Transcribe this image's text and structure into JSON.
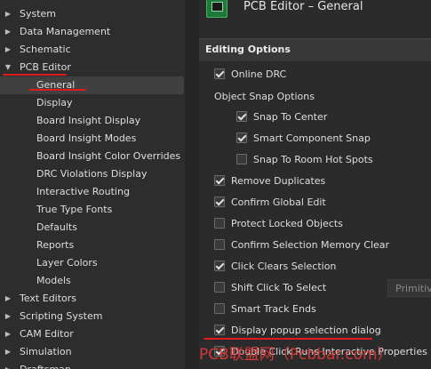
{
  "sidebar": {
    "items": [
      {
        "label": "System",
        "level": 0,
        "expanded": false
      },
      {
        "label": "Data Management",
        "level": 0,
        "expanded": false
      },
      {
        "label": "Schematic",
        "level": 0,
        "expanded": false
      },
      {
        "label": "PCB Editor",
        "level": 0,
        "expanded": true
      },
      {
        "label": "General",
        "level": 1,
        "selected": true
      },
      {
        "label": "Display",
        "level": 1
      },
      {
        "label": "Board Insight Display",
        "level": 1
      },
      {
        "label": "Board Insight Modes",
        "level": 1
      },
      {
        "label": "Board Insight Color Overrides",
        "level": 1
      },
      {
        "label": "DRC Violations Display",
        "level": 1
      },
      {
        "label": "Interactive Routing",
        "level": 1
      },
      {
        "label": "True Type Fonts",
        "level": 1
      },
      {
        "label": "Defaults",
        "level": 1
      },
      {
        "label": "Reports",
        "level": 1
      },
      {
        "label": "Layer Colors",
        "level": 1
      },
      {
        "label": "Models",
        "level": 1
      },
      {
        "label": "Text Editors",
        "level": 0,
        "expanded": false
      },
      {
        "label": "Scripting System",
        "level": 0,
        "expanded": false
      },
      {
        "label": "CAM Editor",
        "level": 0,
        "expanded": false
      },
      {
        "label": "Simulation",
        "level": 0,
        "expanded": false
      },
      {
        "label": "Draftsman",
        "level": 0,
        "expanded": false
      }
    ]
  },
  "header": {
    "title": "PCB Editor – General",
    "icon": "pcb-chip-icon"
  },
  "section": {
    "title": "Editing Options"
  },
  "options": {
    "online_drc": {
      "label": "Online DRC",
      "checked": true
    },
    "snap_group_label": "Object Snap Options",
    "snap_to_center": {
      "label": "Snap To Center",
      "checked": true
    },
    "smart_component_snap": {
      "label": "Smart Component Snap",
      "checked": true
    },
    "snap_to_room_hot_spots": {
      "label": "Snap To Room Hot Spots",
      "checked": false
    },
    "remove_duplicates": {
      "label": "Remove Duplicates",
      "checked": true
    },
    "confirm_global_edit": {
      "label": "Confirm Global Edit",
      "checked": true
    },
    "protect_locked_objects": {
      "label": "Protect Locked Objects",
      "checked": false
    },
    "confirm_selection_memory_clear": {
      "label": "Confirm Selection Memory Clear",
      "checked": false
    },
    "click_clears_selection": {
      "label": "Click Clears Selection",
      "checked": true
    },
    "shift_click_to_select": {
      "label": "Shift Click To Select",
      "checked": false
    },
    "smart_track_ends": {
      "label": "Smart Track Ends",
      "checked": false
    },
    "display_popup_selection_dialog": {
      "label": "Display popup selection dialog",
      "checked": true
    },
    "double_click_runs_interactive_properties": {
      "label": "Double Click Runs Interactive Properties",
      "checked": true
    }
  },
  "primitives_button": {
    "label": "Primitives"
  },
  "watermark": {
    "text": "PCB联盟网（Pcbbar.com）"
  },
  "colors": {
    "annotation_red": "#e01b1b",
    "selection_bg": "#404040"
  }
}
